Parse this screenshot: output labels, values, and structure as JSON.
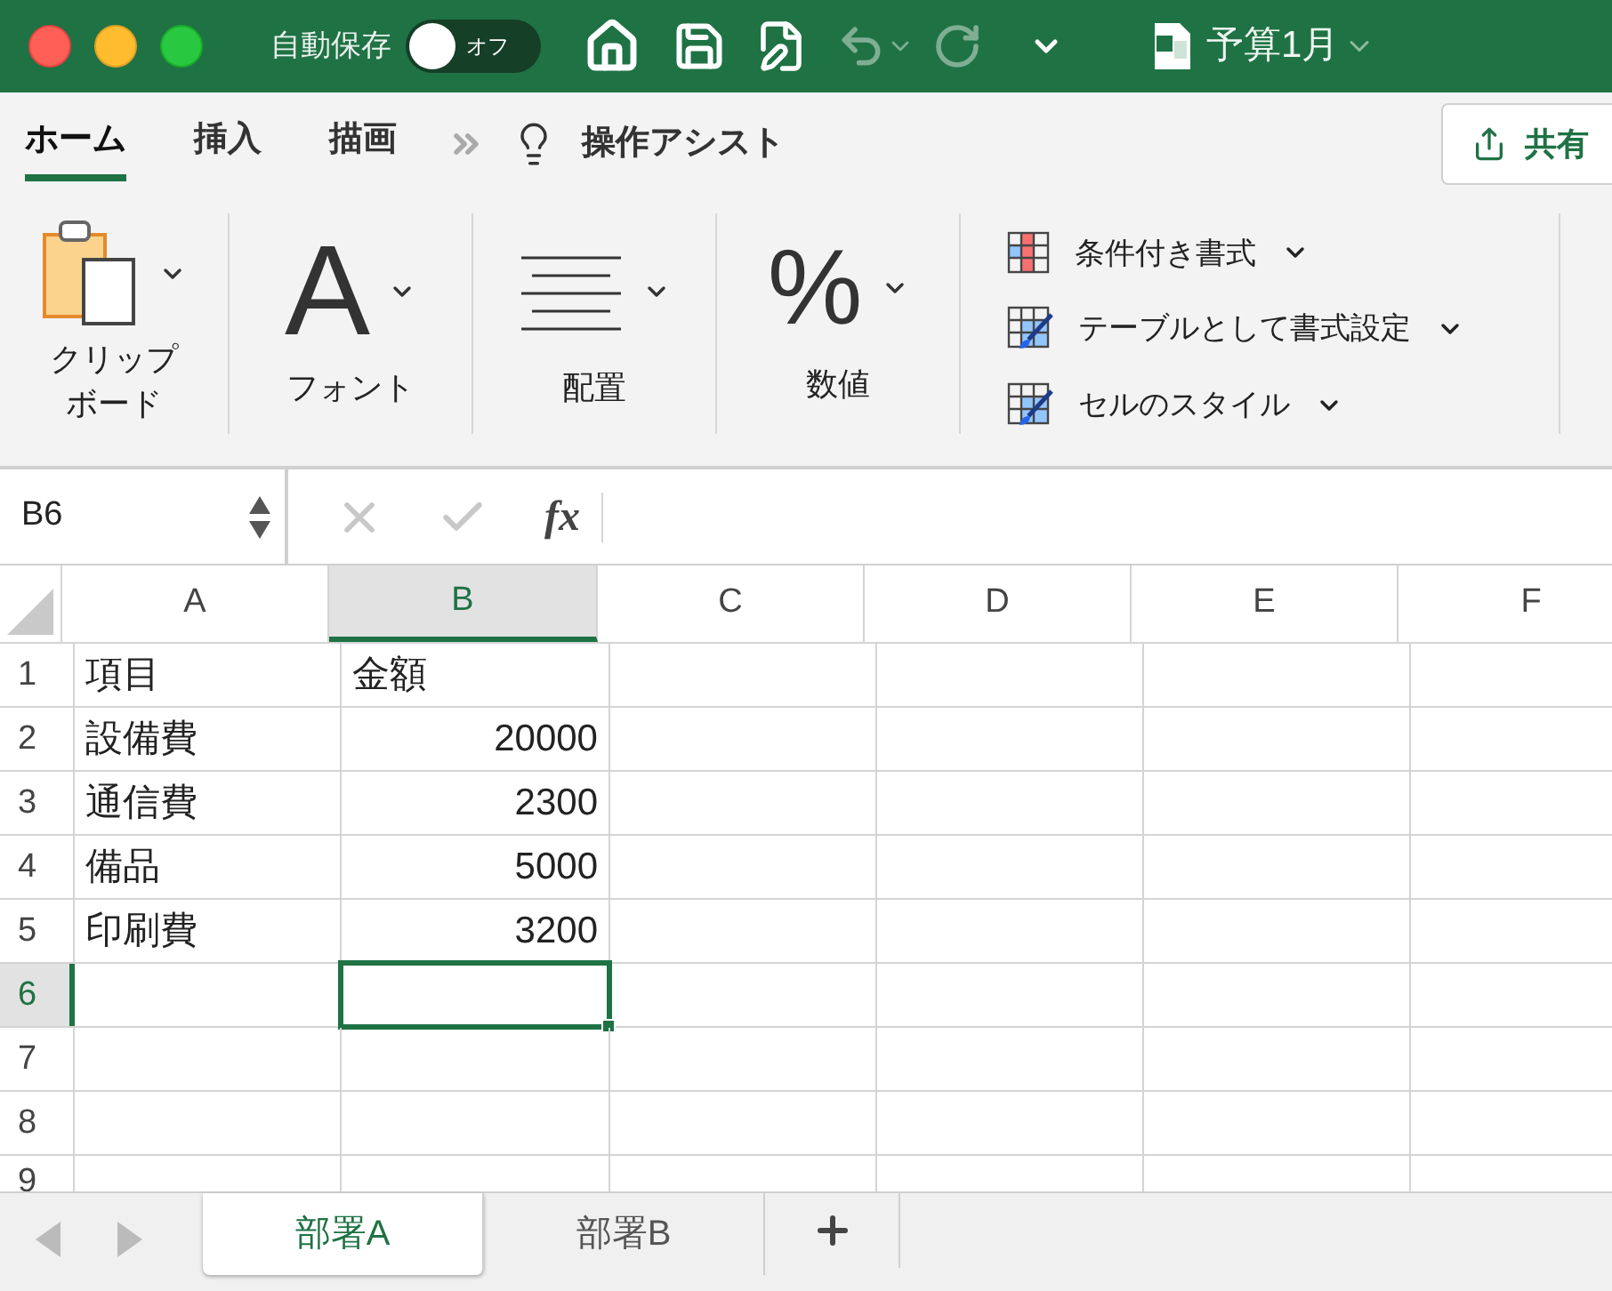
{
  "titlebar": {
    "autosave_label": "自動保存",
    "autosave": {
      "label": "オフ",
      "on": false
    },
    "document_title": "予算1月"
  },
  "ribbon_tabs": [
    {
      "label": "ホーム",
      "selected": true
    },
    {
      "label": "挿入",
      "selected": false
    },
    {
      "label": "描画",
      "selected": false
    }
  ],
  "assist": "操作アシスト",
  "share": "共有",
  "ribbon_groups": [
    {
      "kind": "clipboard",
      "label": "クリップボード"
    },
    {
      "kind": "font",
      "glyph": "A",
      "label": "フォント"
    },
    {
      "kind": "alignment",
      "label": "配置"
    },
    {
      "kind": "number",
      "glyph": "%",
      "label": "数値"
    }
  ],
  "style_commands": [
    {
      "kind": "conditional",
      "label": "条件付き書式"
    },
    {
      "kind": "table",
      "label": "テーブルとして書式設定"
    },
    {
      "kind": "cell",
      "label": "セルのスタイル"
    }
  ],
  "formula_bar": {
    "name_box": "B6",
    "function_label": "fx"
  },
  "columns": [
    {
      "label": "A",
      "selected": false
    },
    {
      "label": "B",
      "selected": true
    },
    {
      "label": "C",
      "selected": false
    },
    {
      "label": "D",
      "selected": false
    },
    {
      "label": "E",
      "selected": false
    },
    {
      "label": "F",
      "selected": false
    }
  ],
  "rows": [
    {
      "label": "1",
      "selected": false,
      "cells": [
        {
          "text": "項目",
          "kind": "text"
        },
        {
          "text": "金額",
          "kind": "text"
        }
      ]
    },
    {
      "label": "2",
      "selected": false,
      "cells": [
        {
          "text": "設備費",
          "kind": "text"
        },
        {
          "text": "20000",
          "kind": "number"
        }
      ]
    },
    {
      "label": "3",
      "selected": false,
      "cells": [
        {
          "text": "通信費",
          "kind": "text"
        },
        {
          "text": "2300",
          "kind": "number"
        }
      ]
    },
    {
      "label": "4",
      "selected": false,
      "cells": [
        {
          "text": "備品",
          "kind": "text"
        },
        {
          "text": "5000",
          "kind": "number"
        }
      ]
    },
    {
      "label": "5",
      "selected": false,
      "cells": [
        {
          "text": "印刷費",
          "kind": "text"
        },
        {
          "text": "3200",
          "kind": "number"
        }
      ]
    },
    {
      "label": "6",
      "selected": true
    },
    {
      "label": "7",
      "selected": false
    },
    {
      "label": "8",
      "selected": false
    },
    {
      "label": "9",
      "selected": false
    }
  ],
  "sheets": [
    {
      "label": "部署A",
      "selected": true
    },
    {
      "label": "部署B",
      "selected": false
    }
  ]
}
